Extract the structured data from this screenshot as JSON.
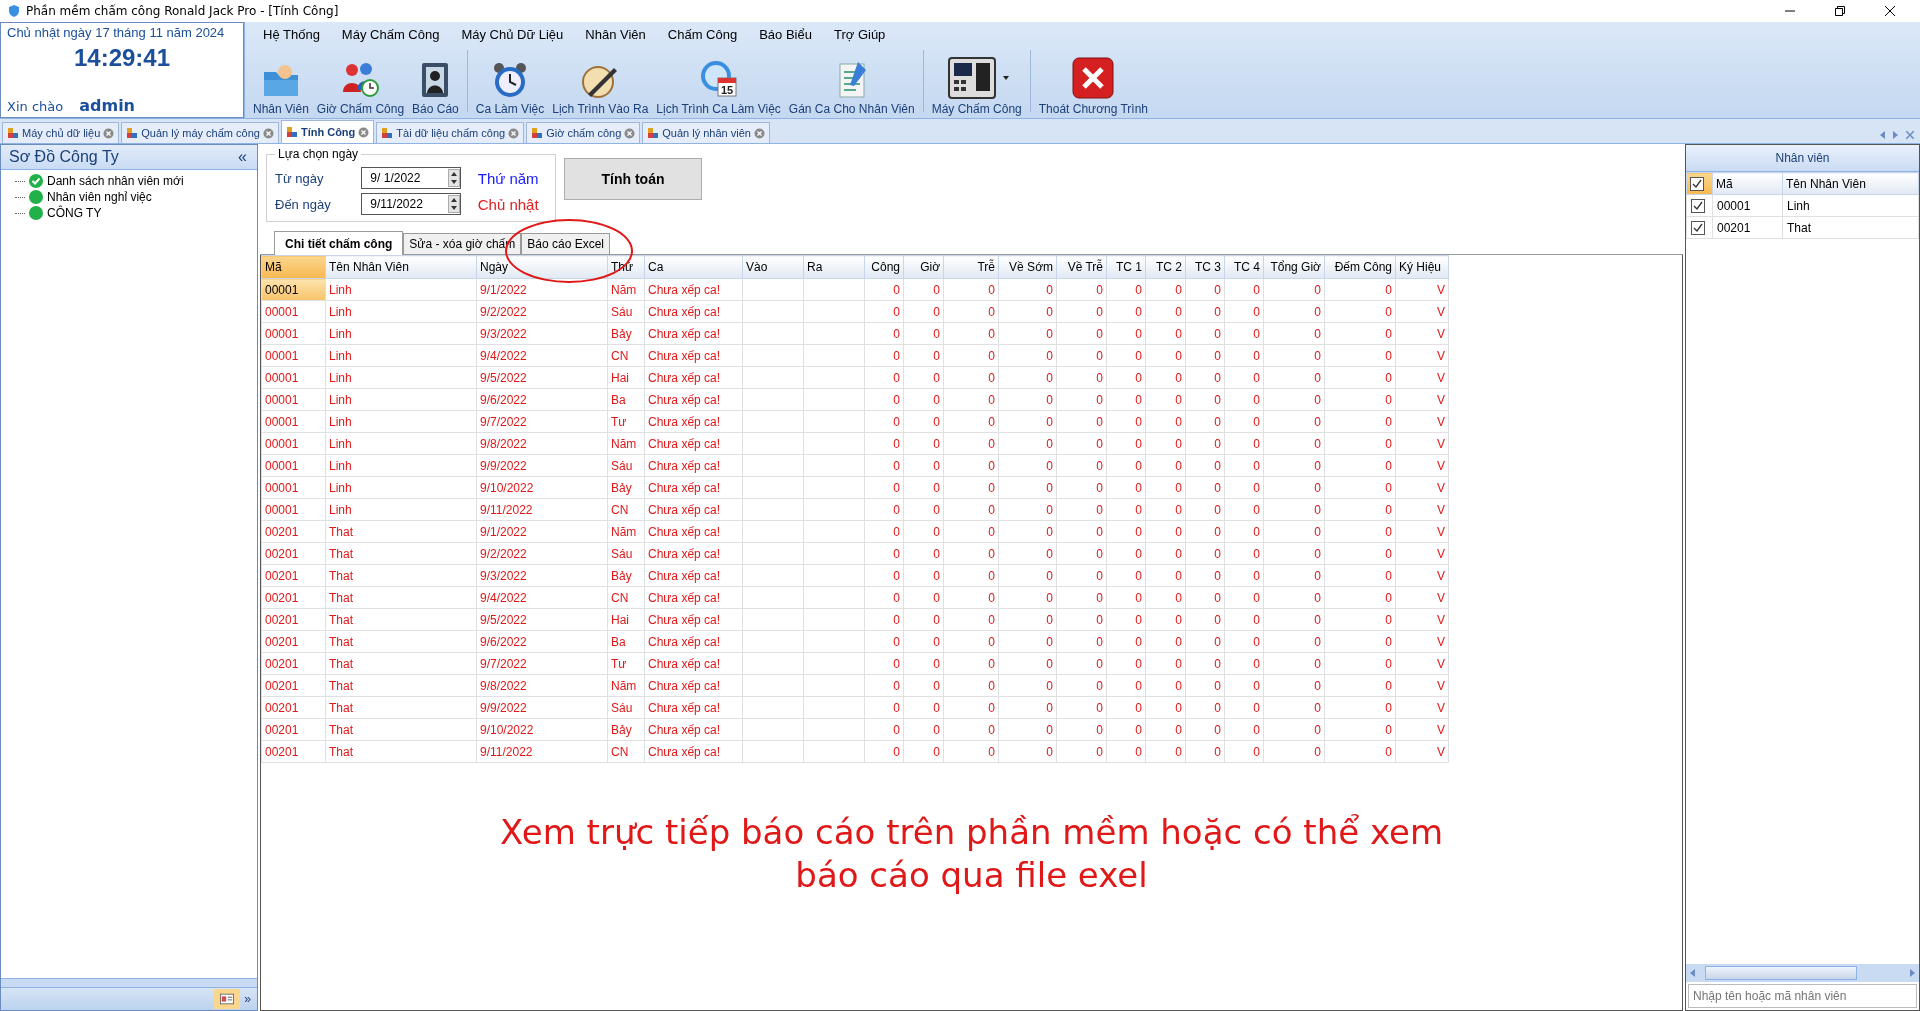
{
  "window": {
    "title": "Phần mềm chấm công Ronald Jack Pro - [Tính Công]"
  },
  "header": {
    "date": "Chủ nhật ngày 17 tháng 11 năm 2024",
    "time": "14:29:41",
    "greeting": "Xin chào",
    "user": "admin"
  },
  "menu": [
    "Hệ Thống",
    "Máy Chấm Công",
    "Máy Chủ Dữ Liệu",
    "Nhân Viên",
    "Chấm Công",
    "Báo Biểu",
    "Trợ Giúp"
  ],
  "toolbar": [
    {
      "label": "Nhân Viên",
      "kind": "folder"
    },
    {
      "label": "Giờ Chấm Công",
      "kind": "people"
    },
    {
      "label": "Báo Cáo",
      "kind": "book"
    },
    {
      "label": "Ca Làm Việc",
      "kind": "alarm"
    },
    {
      "label": "Lịch Trình Vào Ra",
      "kind": "pen"
    },
    {
      "label": "Lịch Trình Ca Làm Việc",
      "kind": "calendar",
      "badge": "15"
    },
    {
      "label": "Gán Ca Cho Nhân Viên",
      "kind": "clipboard"
    },
    {
      "label": "Máy Chấm Công",
      "kind": "device",
      "dropdown": true
    },
    {
      "label": "Thoát Chương Trình",
      "kind": "exit"
    }
  ],
  "doc_tabs": [
    {
      "label": "Máy chủ dữ liệu",
      "selected": false
    },
    {
      "label": "Quản lý máy chấm công",
      "selected": false
    },
    {
      "label": "Tính Công",
      "selected": true
    },
    {
      "label": "Tài dữ liệu chấm công",
      "selected": false
    },
    {
      "label": "Giờ chấm công",
      "selected": false
    },
    {
      "label": "Quản lý nhân viên",
      "selected": false
    }
  ],
  "sidebar": {
    "title": "Sơ Đồ Công Ty",
    "collapse": "«",
    "items": [
      {
        "label": "Danh sách nhân viên mới",
        "kind": "check"
      },
      {
        "label": "Nhân viên nghỉ việc",
        "kind": "dot"
      },
      {
        "label": "CÔNG TY",
        "kind": "dot"
      }
    ],
    "footer_button": "»"
  },
  "date_range": {
    "title": "Lựa chọn ngày",
    "rows": [
      {
        "label": "Từ ngày",
        "value": "9/ 1/2022",
        "weekday": "Thứ năm",
        "color": "#1a1aff"
      },
      {
        "label": "Đến ngày",
        "value": "9/11/2022",
        "weekday": "Chủ nhật",
        "color": "#e02020"
      }
    ]
  },
  "calculate_button": "Tính toán",
  "sub_tabs": [
    {
      "label": "Chi tiết chấm công",
      "selected": true
    },
    {
      "label": "Sửa - xóa giờ chấm",
      "selected": false
    },
    {
      "label": "Báo cáo Excel",
      "selected": false,
      "circled": true
    }
  ],
  "table": {
    "columns": [
      "Mã",
      "Tên Nhân Viên",
      "Ngày",
      "Thứ",
      "Ca",
      "Vào",
      "Ra",
      "Công",
      "Giờ",
      "Trễ",
      "Về Sớm",
      "Về Trễ",
      "TC 1",
      "TC 2",
      "TC 3",
      "TC 4",
      "Tổng Giờ",
      "Đếm Công",
      "Ký Hiệu"
    ],
    "rows": [
      {
        "selected": true,
        "cells": [
          "00001",
          "Linh",
          "9/1/2022",
          "Năm",
          "Chưa xếp ca!",
          "",
          "",
          "0",
          "0",
          "0",
          "0",
          "0",
          "0",
          "0",
          "0",
          "0",
          "0",
          "0",
          "V"
        ]
      },
      {
        "selected": false,
        "cells": [
          "00001",
          "Linh",
          "9/2/2022",
          "Sáu",
          "Chưa xếp ca!",
          "",
          "",
          "0",
          "0",
          "0",
          "0",
          "0",
          "0",
          "0",
          "0",
          "0",
          "0",
          "0",
          "V"
        ]
      },
      {
        "selected": false,
        "cells": [
          "00001",
          "Linh",
          "9/3/2022",
          "Bảy",
          "Chưa xếp ca!",
          "",
          "",
          "0",
          "0",
          "0",
          "0",
          "0",
          "0",
          "0",
          "0",
          "0",
          "0",
          "0",
          "V"
        ]
      },
      {
        "selected": false,
        "cells": [
          "00001",
          "Linh",
          "9/4/2022",
          "CN",
          "Chưa xếp ca!",
          "",
          "",
          "0",
          "0",
          "0",
          "0",
          "0",
          "0",
          "0",
          "0",
          "0",
          "0",
          "0",
          "V"
        ]
      },
      {
        "selected": false,
        "cells": [
          "00001",
          "Linh",
          "9/5/2022",
          "Hai",
          "Chưa xếp ca!",
          "",
          "",
          "0",
          "0",
          "0",
          "0",
          "0",
          "0",
          "0",
          "0",
          "0",
          "0",
          "0",
          "V"
        ]
      },
      {
        "selected": false,
        "cells": [
          "00001",
          "Linh",
          "9/6/2022",
          "Ba",
          "Chưa xếp ca!",
          "",
          "",
          "0",
          "0",
          "0",
          "0",
          "0",
          "0",
          "0",
          "0",
          "0",
          "0",
          "0",
          "V"
        ]
      },
      {
        "selected": false,
        "cells": [
          "00001",
          "Linh",
          "9/7/2022",
          "Tư",
          "Chưa xếp ca!",
          "",
          "",
          "0",
          "0",
          "0",
          "0",
          "0",
          "0",
          "0",
          "0",
          "0",
          "0",
          "0",
          "V"
        ]
      },
      {
        "selected": false,
        "cells": [
          "00001",
          "Linh",
          "9/8/2022",
          "Năm",
          "Chưa xếp ca!",
          "",
          "",
          "0",
          "0",
          "0",
          "0",
          "0",
          "0",
          "0",
          "0",
          "0",
          "0",
          "0",
          "V"
        ]
      },
      {
        "selected": false,
        "cells": [
          "00001",
          "Linh",
          "9/9/2022",
          "Sáu",
          "Chưa xếp ca!",
          "",
          "",
          "0",
          "0",
          "0",
          "0",
          "0",
          "0",
          "0",
          "0",
          "0",
          "0",
          "0",
          "V"
        ]
      },
      {
        "selected": false,
        "cells": [
          "00001",
          "Linh",
          "9/10/2022",
          "Bảy",
          "Chưa xếp ca!",
          "",
          "",
          "0",
          "0",
          "0",
          "0",
          "0",
          "0",
          "0",
          "0",
          "0",
          "0",
          "0",
          "V"
        ]
      },
      {
        "selected": false,
        "cells": [
          "00001",
          "Linh",
          "9/11/2022",
          "CN",
          "Chưa xếp ca!",
          "",
          "",
          "0",
          "0",
          "0",
          "0",
          "0",
          "0",
          "0",
          "0",
          "0",
          "0",
          "0",
          "V"
        ]
      },
      {
        "selected": false,
        "cells": [
          "00201",
          "That",
          "9/1/2022",
          "Năm",
          "Chưa xếp ca!",
          "",
          "",
          "0",
          "0",
          "0",
          "0",
          "0",
          "0",
          "0",
          "0",
          "0",
          "0",
          "0",
          "V"
        ]
      },
      {
        "selected": false,
        "cells": [
          "00201",
          "That",
          "9/2/2022",
          "Sáu",
          "Chưa xếp ca!",
          "",
          "",
          "0",
          "0",
          "0",
          "0",
          "0",
          "0",
          "0",
          "0",
          "0",
          "0",
          "0",
          "V"
        ]
      },
      {
        "selected": false,
        "cells": [
          "00201",
          "That",
          "9/3/2022",
          "Bảy",
          "Chưa xếp ca!",
          "",
          "",
          "0",
          "0",
          "0",
          "0",
          "0",
          "0",
          "0",
          "0",
          "0",
          "0",
          "0",
          "V"
        ]
      },
      {
        "selected": false,
        "cells": [
          "00201",
          "That",
          "9/4/2022",
          "CN",
          "Chưa xếp ca!",
          "",
          "",
          "0",
          "0",
          "0",
          "0",
          "0",
          "0",
          "0",
          "0",
          "0",
          "0",
          "0",
          "V"
        ]
      },
      {
        "selected": false,
        "cells": [
          "00201",
          "That",
          "9/5/2022",
          "Hai",
          "Chưa xếp ca!",
          "",
          "",
          "0",
          "0",
          "0",
          "0",
          "0",
          "0",
          "0",
          "0",
          "0",
          "0",
          "0",
          "V"
        ]
      },
      {
        "selected": false,
        "cells": [
          "00201",
          "That",
          "9/6/2022",
          "Ba",
          "Chưa xếp ca!",
          "",
          "",
          "0",
          "0",
          "0",
          "0",
          "0",
          "0",
          "0",
          "0",
          "0",
          "0",
          "0",
          "V"
        ]
      },
      {
        "selected": false,
        "cells": [
          "00201",
          "That",
          "9/7/2022",
          "Tư",
          "Chưa xếp ca!",
          "",
          "",
          "0",
          "0",
          "0",
          "0",
          "0",
          "0",
          "0",
          "0",
          "0",
          "0",
          "0",
          "V"
        ]
      },
      {
        "selected": false,
        "cells": [
          "00201",
          "That",
          "9/8/2022",
          "Năm",
          "Chưa xếp ca!",
          "",
          "",
          "0",
          "0",
          "0",
          "0",
          "0",
          "0",
          "0",
          "0",
          "0",
          "0",
          "0",
          "V"
        ]
      },
      {
        "selected": false,
        "cells": [
          "00201",
          "That",
          "9/9/2022",
          "Sáu",
          "Chưa xếp ca!",
          "",
          "",
          "0",
          "0",
          "0",
          "0",
          "0",
          "0",
          "0",
          "0",
          "0",
          "0",
          "0",
          "V"
        ]
      },
      {
        "selected": false,
        "cells": [
          "00201",
          "That",
          "9/10/2022",
          "Bảy",
          "Chưa xếp ca!",
          "",
          "",
          "0",
          "0",
          "0",
          "0",
          "0",
          "0",
          "0",
          "0",
          "0",
          "0",
          "0",
          "V"
        ]
      },
      {
        "selected": false,
        "cells": [
          "00201",
          "That",
          "9/11/2022",
          "CN",
          "Chưa xếp ca!",
          "",
          "",
          "0",
          "0",
          "0",
          "0",
          "0",
          "0",
          "0",
          "0",
          "0",
          "0",
          "0",
          "V"
        ]
      }
    ]
  },
  "annotation": "Xem trực tiếp báo cáo trên phần mềm hoặc có thể xem báo cáo qua file exel",
  "employee_panel": {
    "title": "Nhân viên",
    "all_checked": true,
    "columns": [
      "Mã",
      "Tên Nhân Viên"
    ],
    "rows": [
      {
        "code": "00001",
        "name": "Linh",
        "checked": true
      },
      {
        "code": "00201",
        "name": "That",
        "checked": true
      }
    ],
    "search_placeholder": "Nhập tên hoặc mã nhân viên"
  }
}
